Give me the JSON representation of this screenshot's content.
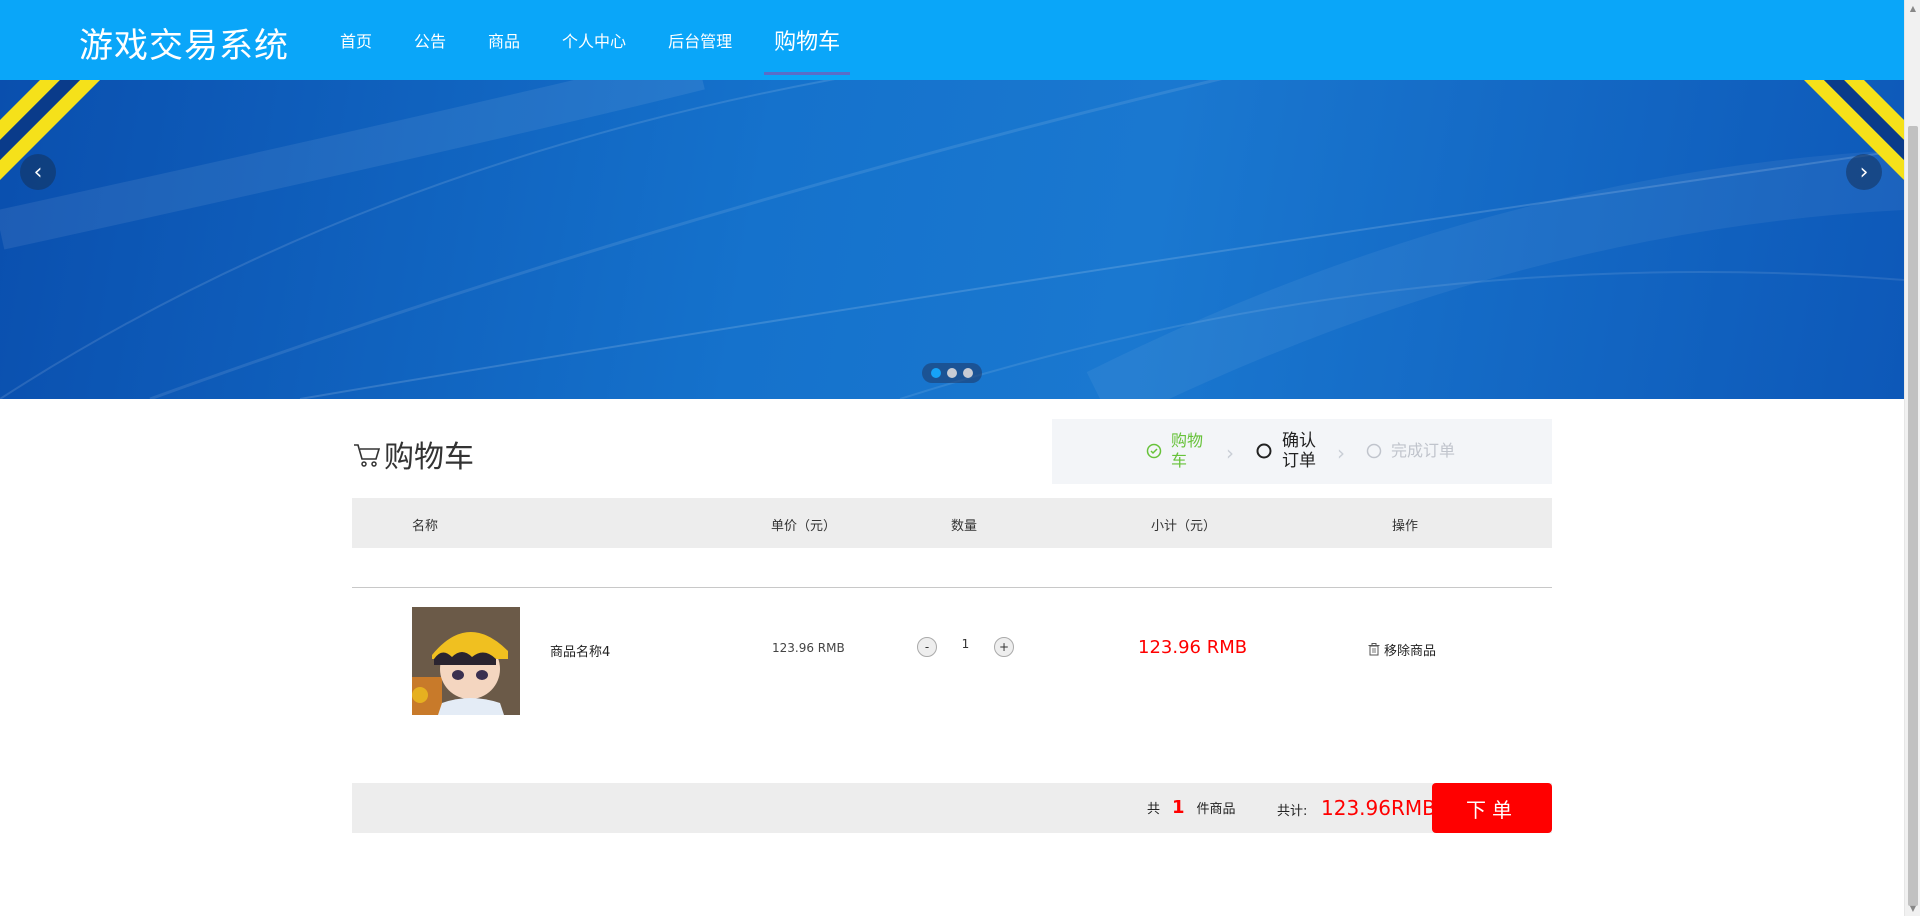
{
  "header": {
    "brand": "游戏交易系统",
    "nav": [
      "首页",
      "公告",
      "商品",
      "个人中心",
      "后台管理",
      "购物车"
    ],
    "active_nav": "购物车",
    "color": "#0aa6f9"
  },
  "banner": {
    "slide_count": 3,
    "active_slide": 1
  },
  "cart": {
    "title": "购物车",
    "steps": {
      "step1": "购物车",
      "step2": "确认订单",
      "step3": "完成订单"
    },
    "columns": {
      "name": "名称",
      "price": "单价（元）",
      "qty": "数量",
      "subtotal": "小计（元）",
      "actions": "操作"
    },
    "items": [
      {
        "name": "商品名称4",
        "price": "123.96 RMB",
        "qty_minus": "-",
        "qty": "1",
        "qty_plus": "+",
        "subtotal": "123.96 RMB",
        "remove": "移除商品"
      }
    ],
    "footer": {
      "count_prefix": "共",
      "count": "1",
      "count_suffix": "件商品",
      "total_label": "共计:",
      "total": "123.96RMB",
      "order_button": "下单"
    },
    "accent_red": "#ff0000",
    "step_done_color": "#67c23a"
  }
}
